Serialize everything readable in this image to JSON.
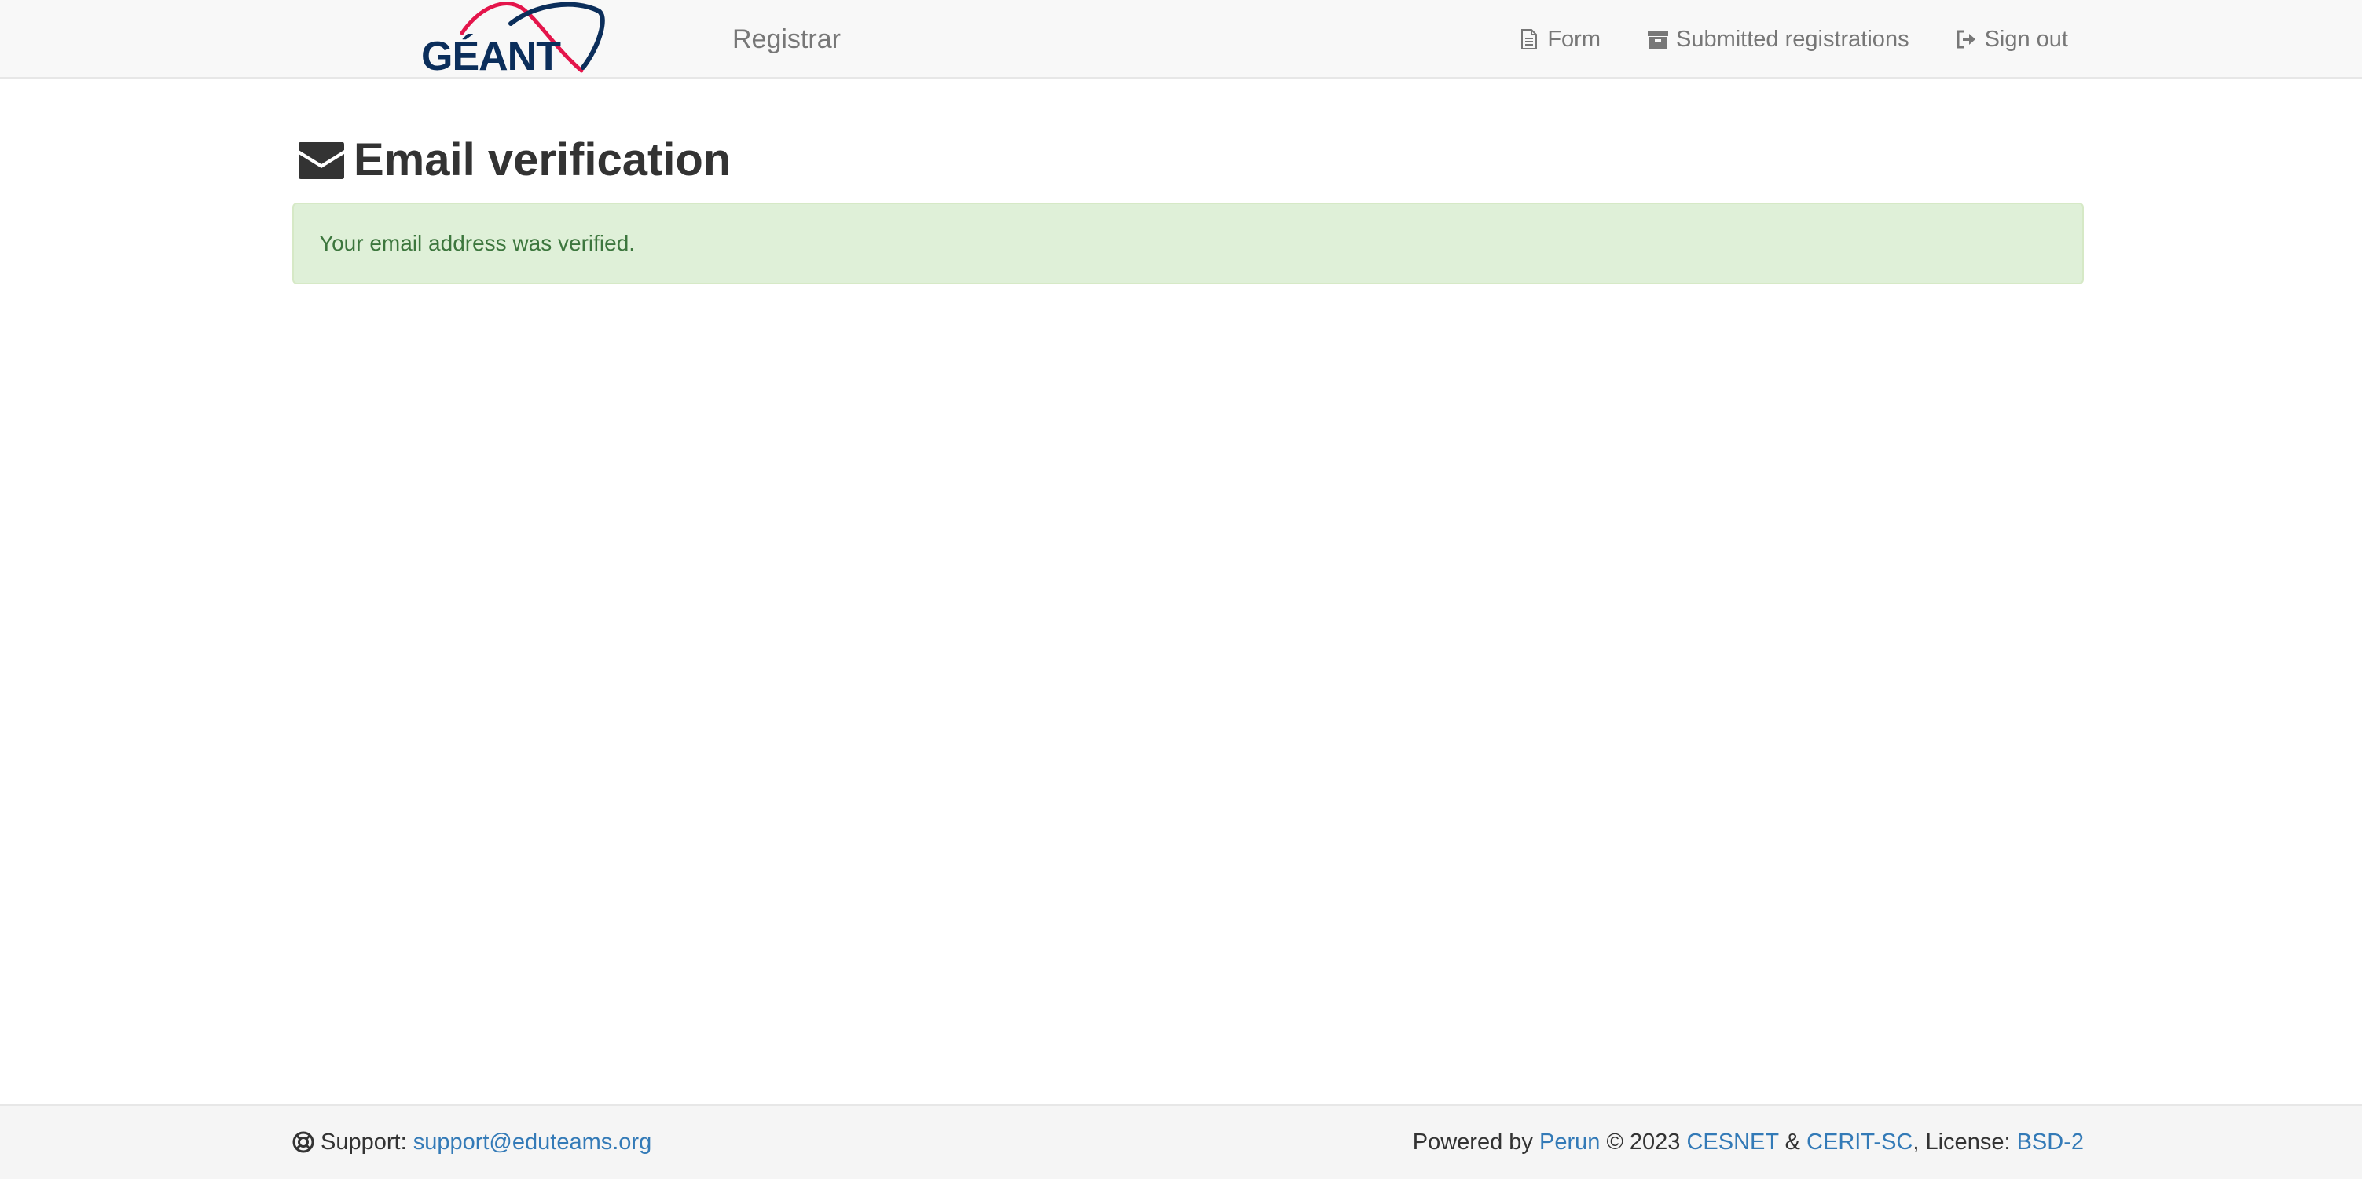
{
  "navbar": {
    "logo": {
      "text": "GÉANT",
      "icon": "geant-logo-swoosh",
      "colors": {
        "swoosh_red": "#e4154b",
        "swoosh_navy": "#0b2e5b"
      }
    },
    "brand_name": "Registrar",
    "links": [
      {
        "label": "Form",
        "icon": "file-icon"
      },
      {
        "label": "Submitted registrations",
        "icon": "archive-icon"
      },
      {
        "label": "Sign out",
        "icon": "sign-out-icon"
      }
    ]
  },
  "main": {
    "title": "Email verification",
    "title_icon": "envelope-icon",
    "alert": {
      "text": "Your email address was verified.",
      "type": "success",
      "colors": {
        "background": "#dff0d8",
        "border": "#d6e9c6",
        "text": "#3c763d"
      }
    }
  },
  "footer": {
    "support_icon": "life-ring-icon",
    "support_label": "Support:",
    "support_email": "support@eduteams.org",
    "powered_by": "Powered by",
    "perun": "Perun",
    "copyright": "© 2023",
    "cesnet": "CESNET",
    "ampersand": "&",
    "cerit": "CERIT-SC",
    "license_label": ", License:",
    "license": "BSD-2",
    "link_color": "#337ab7"
  }
}
